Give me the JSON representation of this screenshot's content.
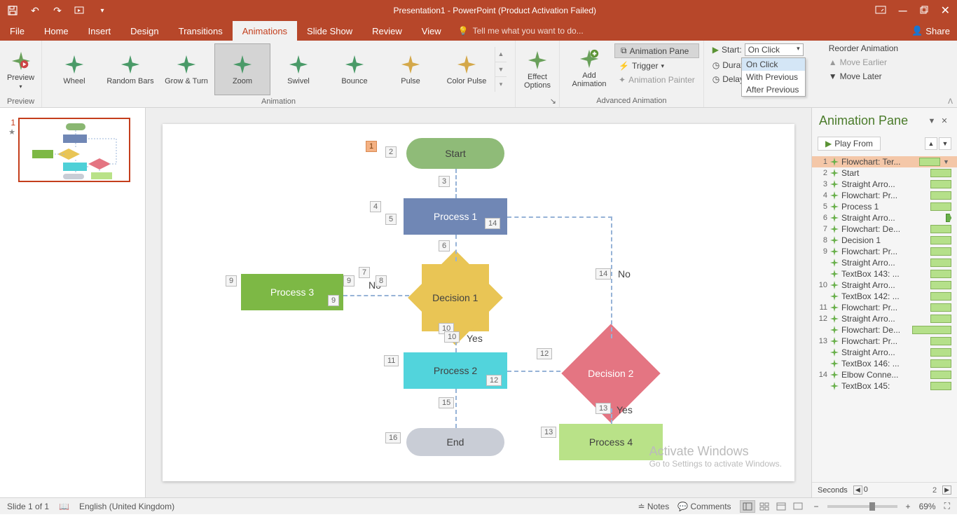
{
  "title": "Presentation1 - PowerPoint (Product Activation Failed)",
  "menu": {
    "file": "File",
    "home": "Home",
    "insert": "Insert",
    "design": "Design",
    "transitions": "Transitions",
    "animations": "Animations",
    "slideshow": "Slide Show",
    "review": "Review",
    "view": "View",
    "tellme": "Tell me what you want to do...",
    "share": "Share"
  },
  "ribbon": {
    "preview": "Preview",
    "preview_group": "Preview",
    "effects": [
      "Wheel",
      "Random Bars",
      "Grow & Turn",
      "Zoom",
      "Swivel",
      "Bounce",
      "Pulse",
      "Color Pulse"
    ],
    "effect_selected_index": 3,
    "animation_group": "Animation",
    "effect_options": "Effect\nOptions",
    "add_animation": "Add\nAnimation",
    "anim_pane_btn": "Animation Pane",
    "trigger": "Trigger",
    "painter": "Animation Painter",
    "advanced_group": "Advanced Animation",
    "start_label": "Start:",
    "start_value": "On Click",
    "duration_label": "Duration:",
    "delay_label": "Delay:",
    "timing_group": "Timing",
    "start_options": [
      "On Click",
      "With Previous",
      "After Previous"
    ],
    "reorder": "Reorder Animation",
    "move_earlier": "Move Earlier",
    "move_later": "Move Later"
  },
  "slide": {
    "start": "Start",
    "p1": "Process 1",
    "p2": "Process 2",
    "p3": "Process 3",
    "p4": "Process 4",
    "d1": "Decision 1",
    "d2": "Decision 2",
    "end": "End",
    "yes": "Yes",
    "no": "No"
  },
  "anim_numbers": {
    "n1": "1",
    "n2": "2",
    "n3": "3",
    "n4": "4",
    "n5": "5",
    "n6": "6",
    "n7": "7",
    "n8": "8",
    "n9": "9",
    "n10": "10",
    "n11": "11",
    "n12": "12",
    "n13": "13",
    "n14": "14",
    "n15": "15",
    "n16": "16"
  },
  "pane": {
    "title": "Animation Pane",
    "play": "Play From",
    "items": [
      {
        "num": "1",
        "label": "Flowchart: Ter...",
        "sel": true,
        "dd": true
      },
      {
        "num": "2",
        "label": "Start"
      },
      {
        "num": "3",
        "label": "Straight Arro..."
      },
      {
        "num": "4",
        "label": "Flowchart: Pr..."
      },
      {
        "num": "5",
        "label": "Process 1"
      },
      {
        "num": "6",
        "label": "Straight Arro...",
        "green_arrow": true
      },
      {
        "num": "7",
        "label": "Flowchart: De..."
      },
      {
        "num": "8",
        "label": "Decision 1"
      },
      {
        "num": "9",
        "label": "Flowchart: Pr..."
      },
      {
        "num": "",
        "label": "Straight Arro..."
      },
      {
        "num": "",
        "label": "TextBox 143: ..."
      },
      {
        "num": "10",
        "label": "Straight Arro..."
      },
      {
        "num": "",
        "label": "TextBox 142: ..."
      },
      {
        "num": "11",
        "label": "Flowchart: Pr..."
      },
      {
        "num": "12",
        "label": "Straight Arro..."
      },
      {
        "num": "",
        "label": "Flowchart: De...",
        "long": true
      },
      {
        "num": "13",
        "label": "Flowchart: Pr..."
      },
      {
        "num": "",
        "label": "Straight Arro..."
      },
      {
        "num": "",
        "label": "TextBox 146: ..."
      },
      {
        "num": "14",
        "label": "Elbow Conne..."
      },
      {
        "num": "",
        "label": "TextBox 145:"
      }
    ],
    "seconds_label": "Seconds",
    "tick0": "0",
    "tick2": "2"
  },
  "status": {
    "slide": "Slide 1 of 1",
    "lang": "English (United Kingdom)",
    "notes": "Notes",
    "comments": "Comments",
    "zoom": "69%"
  },
  "watermark": {
    "title": "Activate Windows",
    "sub": "Go to Settings to activate Windows."
  },
  "thumb_num": "1"
}
